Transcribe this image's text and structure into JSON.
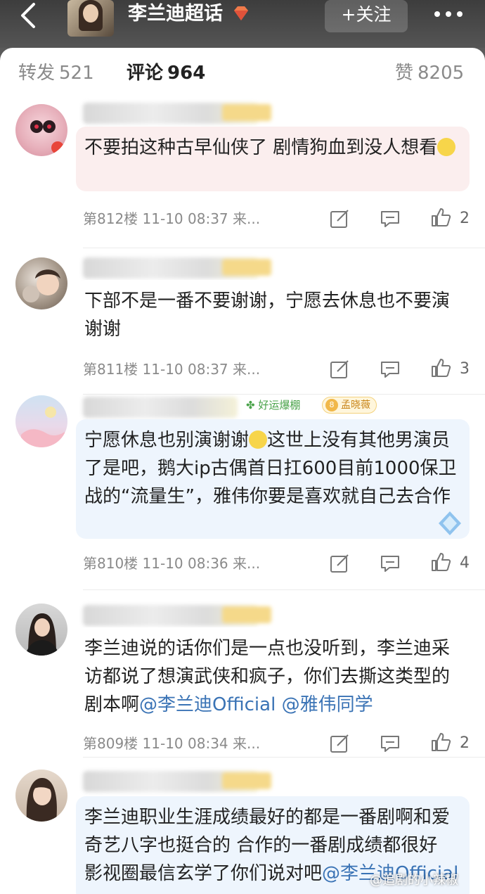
{
  "header": {
    "topic_title": "李兰迪超话",
    "follow_label": "+关注",
    "icons": [
      "back-icon",
      "gem-icon",
      "more-icon"
    ]
  },
  "tabs": {
    "repost": {
      "label": "转发",
      "count": "521"
    },
    "comment": {
      "label": "评论",
      "count": "964"
    },
    "like": {
      "label": "赞",
      "count": "8205"
    }
  },
  "comments": [
    {
      "text": "不要拍这种古早仙侠了 剧情狗血到没人想看",
      "meta": "第812楼  11-10 08:37  来...",
      "likes": "2",
      "bubble_color": "#fdf0f0"
    },
    {
      "text": "下部不是一番不要谢谢，宁愿去休息也不要演谢谢",
      "meta": "第811楼  11-10 08:37  来...",
      "likes": "3",
      "bubble_color": "#ffffff"
    },
    {
      "text": "宁愿休息也别演谢谢",
      "text_rest": "这世上没有其他男演员了是吧，鹅大ip古偶首日扛600目前1000保卫战的“流量生”，雅伟你要是喜欢就自己去合作",
      "badge_luck": "好运爆棚",
      "badge_fan_level": "8",
      "badge_fan": "孟晓薇",
      "meta": "第810楼  11-10 08:36  来...",
      "likes": "4",
      "bubble_color": "#eef5fd"
    },
    {
      "text": "李兰迪说的话你们是一点也没听到，李兰迪采访都说了想演武侠和疯子，你们去撕这类型的剧本啊",
      "mention1": "@李兰迪Official",
      "mention2": "@雅伟同学",
      "meta": "第809楼  11-10 08:34  来...",
      "likes": "2",
      "bubble_color": "#ffffff"
    },
    {
      "text": "李兰迪职业生涯成绩最好的都是一番剧啊和爱奇艺八字也挺合的 合作的一番剧成绩都很好 影视圈最信玄学了你们说对吧",
      "mention1": "@李兰迪Official",
      "bubble_color": "#eef5fd"
    }
  ],
  "watermark": "@追剧的小辣椒",
  "colors": {
    "mention": "#3a73b5",
    "meta": "#8a8a8a"
  }
}
